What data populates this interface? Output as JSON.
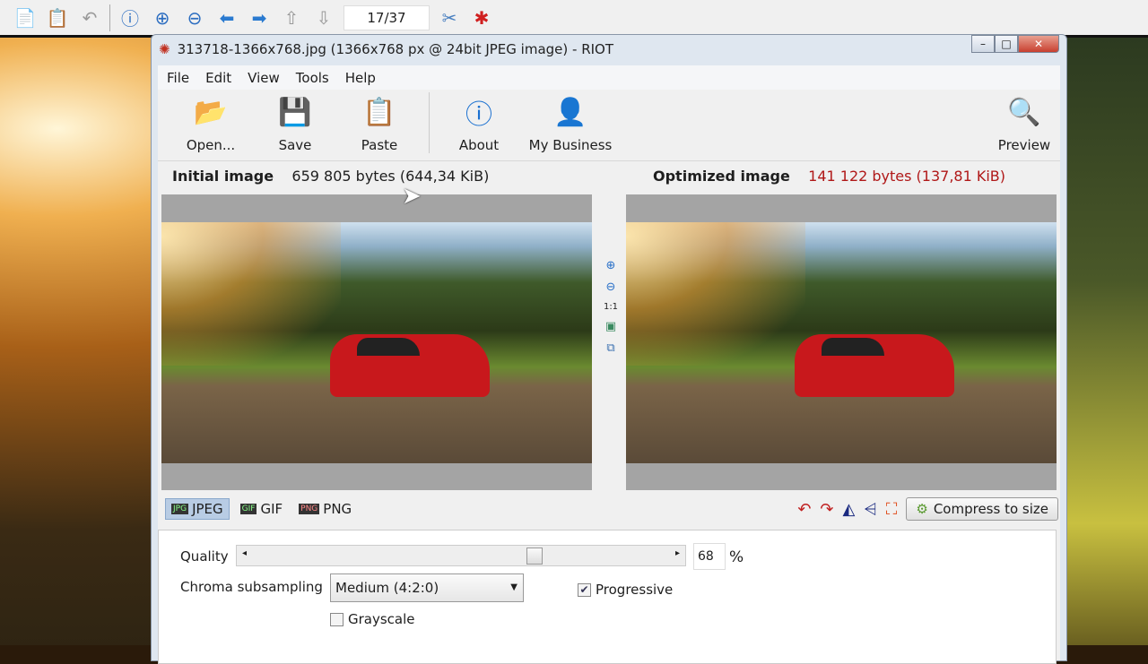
{
  "viewer": {
    "page": "17/37",
    "icons": [
      "copy-icon",
      "paste-icon",
      "undo-icon",
      "info-icon",
      "zoom-in-icon",
      "zoom-out-icon",
      "prev-icon",
      "next-icon",
      "first-page-icon",
      "last-page-icon",
      "tools-icon",
      "plugin-icon"
    ]
  },
  "window": {
    "title": "313718-1366x768.jpg (1366x768 px @ 24bit JPEG image) - RIOT"
  },
  "menu": [
    "File",
    "Edit",
    "View",
    "Tools",
    "Help"
  ],
  "toolbar": {
    "open": "Open...",
    "save": "Save",
    "paste": "Paste",
    "about": "About",
    "business": "My Business",
    "preview": "Preview"
  },
  "info": {
    "initial_label": "Initial image",
    "initial_value": "659 805 bytes (644,34 KiB)",
    "optimized_label": "Optimized image",
    "optimized_value": "141 122 bytes (137,81 KiB)",
    "optimized_color": "#b01818"
  },
  "midtools": {
    "one_to_one": "1:1"
  },
  "formats": [
    {
      "label": "JPEG",
      "icon": "JPG"
    },
    {
      "label": "GIF",
      "icon": "GIF"
    },
    {
      "label": "PNG",
      "icon": "PNG"
    }
  ],
  "compress_label": "Compress to size",
  "settings": {
    "quality_label": "Quality",
    "quality_value": "68",
    "quality_unit": "%",
    "quality_percent": 68,
    "chroma_label": "Chroma subsampling",
    "chroma_value": "Medium (4:2:0)",
    "progressive_label": "Progressive",
    "progressive_checked": true,
    "grayscale_label": "Grayscale",
    "grayscale_checked": false
  }
}
